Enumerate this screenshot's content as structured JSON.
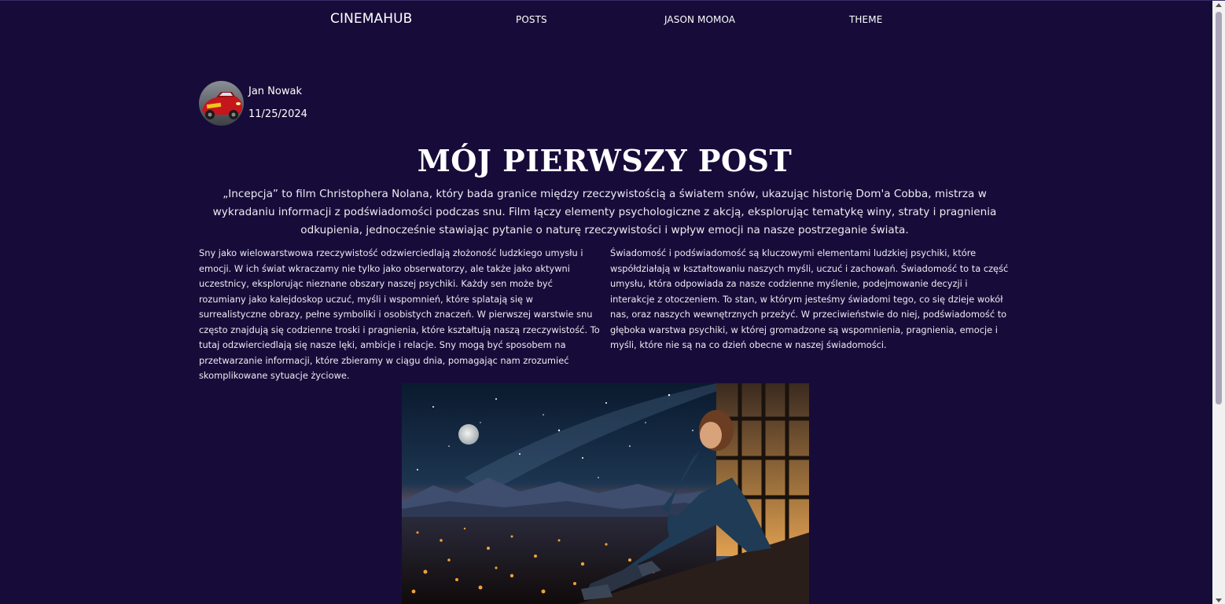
{
  "nav": {
    "brand": "CINEMAHUB",
    "posts": "POSTS",
    "jason": "JASON MOMOA",
    "theme": "THEME"
  },
  "author": {
    "name": "Jan Nowak",
    "date": "11/25/2024",
    "avatar_icon": "race-car-avatar-icon"
  },
  "post": {
    "title": "MÓJ PIERWSZY POST",
    "lead": "„Incepcja” to film Christophera Nolana, który bada granice między rzeczywistością a światem snów, ukazując historię Dom'a Cobba, mistrza w wykradaniu informacji z podświadomości podczas snu. Film łączy elementy psychologiczne z akcją, eksplorując tematykę winy, straty i pragnienia odkupienia, jednocześnie stawiając pytanie o naturę rzeczywistości i wpływ emocji na nasze postrzeganie świata.",
    "col_left": "Sny jako wielowarstwowa rzeczywistość odzwierciedlają złożoność ludzkiego umysłu i emocji. W ich świat wkraczamy nie tylko jako obserwatorzy, ale także jako aktywni uczestnicy, eksplorując nieznane obszary naszej psychiki. Każdy sen może być rozumiany jako kalejdoskop uczuć, myśli i wspomnień, które splatają się w surrealistyczne obrazy, pełne symboliki i osobistych znaczeń. W pierwszej warstwie snu często znajdują się codzienne troski i pragnienia, które kształtują naszą rzeczywistość. To tutaj odzwierciedlają się nasze lęki, ambicje i relacje. Sny mogą być sposobem na przetwarzanie informacji, które zbieramy w ciągu dnia, pomagając nam zrozumieć skomplikowane sytuacje życiowe.",
    "col_right": "Świadomość i podświadomość są kluczowymi elementami ludzkiej psychiki, które współdziałają w kształtowaniu naszych myśli, uczuć i zachowań. Świadomość to ta część umysłu, która odpowiada za nasze codzienne myślenie, podejmowanie decyzji i interakcje z otoczeniem. To stan, w którym jesteśmy świadomi tego, co się dzieje wokół nas, oraz naszych wewnętrznych przeżyć. W przeciwieństwie do niej, podświadomość to głęboka warstwa psychiki, w której gromadzone są wspomnienia, pragnienia, emocje i myśli, które nie są na co dzień obecne w naszej świadomości."
  },
  "hero": {
    "icon": "night-city-girl-illustration"
  },
  "colors": {
    "background": "#170c39",
    "text": "#ffffff"
  }
}
